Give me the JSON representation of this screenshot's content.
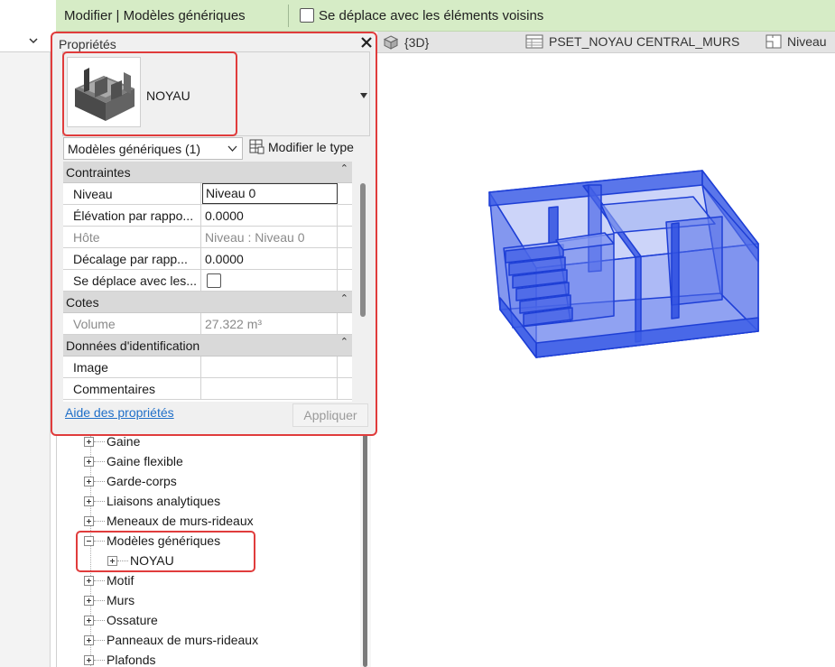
{
  "ribbon": {
    "context_title": "Modifier | Modèles génériques",
    "moves_with_nearby": "Se déplace avec les éléments voisins"
  },
  "view_tabs": [
    {
      "label": "{3D}",
      "icon": "3d-cube-icon"
    },
    {
      "label": "PSET_NOYAU CENTRAL_MURS",
      "icon": "schedule-table-icon"
    },
    {
      "label": "Niveau",
      "icon": "floor-plan-icon"
    }
  ],
  "properties": {
    "title": "Propriétés",
    "type_name": "NOYAU",
    "filter": "Modèles génériques (1)",
    "edit_type": "Modifier le type",
    "sections": {
      "constraints": "Contraintes",
      "dimensions": "Cotes",
      "identity": "Données d'identification"
    },
    "rows": {
      "level": {
        "label": "Niveau",
        "value": "Niveau 0"
      },
      "elevation": {
        "label": "Élévation par rappo...",
        "value": "0.0000"
      },
      "host": {
        "label": "Hôte",
        "value": "Niveau : Niveau 0"
      },
      "offset": {
        "label": "Décalage par rapp...",
        "value": "0.0000"
      },
      "moves": {
        "label": "Se déplace avec les..."
      },
      "volume": {
        "label": "Volume",
        "value": "27.322 m³"
      },
      "image": {
        "label": "Image",
        "value": ""
      },
      "comments": {
        "label": "Commentaires",
        "value": ""
      }
    },
    "help_link": "Aide des propriétés",
    "apply": "Appliquer"
  },
  "browser": {
    "items": [
      {
        "label": "Gaine",
        "expanded": false
      },
      {
        "label": "Gaine flexible",
        "expanded": false
      },
      {
        "label": "Garde-corps",
        "expanded": false
      },
      {
        "label": "Liaisons analytiques",
        "expanded": false
      },
      {
        "label": "Meneaux de murs-rideaux",
        "expanded": false
      },
      {
        "label": "Modèles génériques",
        "expanded": true
      },
      {
        "label": "NOYAU",
        "expanded": false,
        "child": true
      },
      {
        "label": "Motif",
        "expanded": false
      },
      {
        "label": "Murs",
        "expanded": false
      },
      {
        "label": "Ossature",
        "expanded": false
      },
      {
        "label": "Panneaux de murs-rideaux",
        "expanded": false
      },
      {
        "label": "Plafonds",
        "expanded": false
      }
    ]
  },
  "colors": {
    "highlight_red": "#e03c3c",
    "selection_blue": "#2a4fe0",
    "ribbon_green": "#d6ecc6",
    "link_blue": "#1f6fc8"
  }
}
